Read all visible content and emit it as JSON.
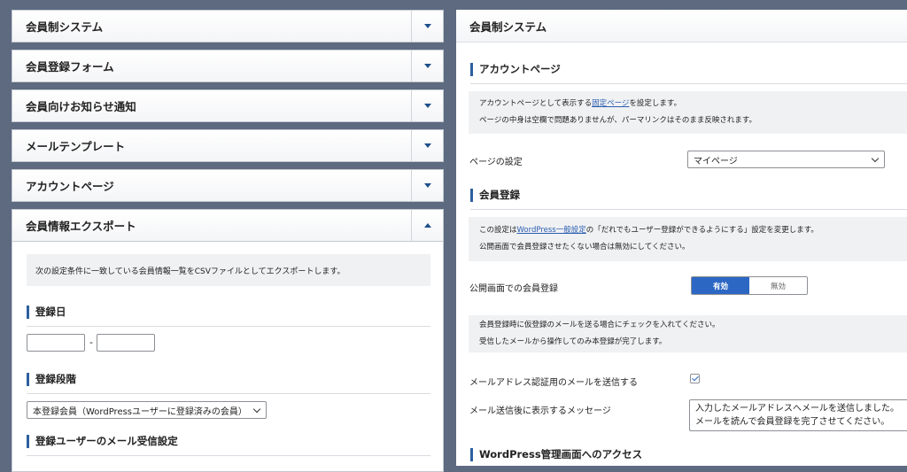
{
  "left": {
    "accordions": [
      {
        "title": "会員制システム"
      },
      {
        "title": "会員登録フォーム"
      },
      {
        "title": "会員向けお知らせ通知"
      },
      {
        "title": "メールテンプレート"
      },
      {
        "title": "アカウントページ"
      }
    ],
    "open_section": {
      "title": "会員情報エクスポート",
      "description": "次の設定条件に一致している会員情報一覧をCSVファイルとしてエクスポートします。",
      "registration_date": {
        "heading": "登録日",
        "separator": "-"
      },
      "registration_stage": {
        "heading": "登録段階",
        "selected": "本登録会員（WordPressユーザーに登録済みの会員）"
      },
      "mail_receive": {
        "heading": "登録ユーザーのメール受信設定"
      }
    }
  },
  "right": {
    "header": "会員制システム",
    "account_page": {
      "heading": "アカウントページ",
      "desc_line1_pre": "アカウントページとして表示する",
      "desc_line1_link": "固定ページ",
      "desc_line1_post": "を設定します。",
      "desc_line2": "ページの中身は空欄で問題ありませんが、パーマリンクはそのまま反映されます。",
      "page_setting_label": "ページの設定",
      "page_setting_value": "マイページ"
    },
    "member_registration": {
      "heading": "会員登録",
      "desc_line1_pre": "この設定は",
      "desc_line1_link": "WordPress一般設定",
      "desc_line1_post": "の「だれでもユーザー登録ができるようにする」設定を変更します。",
      "desc_line2": "公開画面で会員登録させたくない場合は無効にしてください。",
      "public_registration_label": "公開画面での会員登録",
      "toggle_on": "有効",
      "toggle_off": "無効",
      "verify_desc_line1": "会員登録時に仮登録のメールを送る場合にチェックを入れてください。",
      "verify_desc_line2": "受信したメールから操作してのみ本登録が完了します。",
      "send_verify_label": "メールアドレス認証用のメールを送信する",
      "message_label": "メール送信後に表示するメッセージ",
      "message_line1": "入力したメールアドレスへメールを送信しました。",
      "message_line2": "メールを読んで会員登録を完了させてください。"
    },
    "admin_access": {
      "heading": "WordPress管理画面へのアクセス"
    }
  }
}
